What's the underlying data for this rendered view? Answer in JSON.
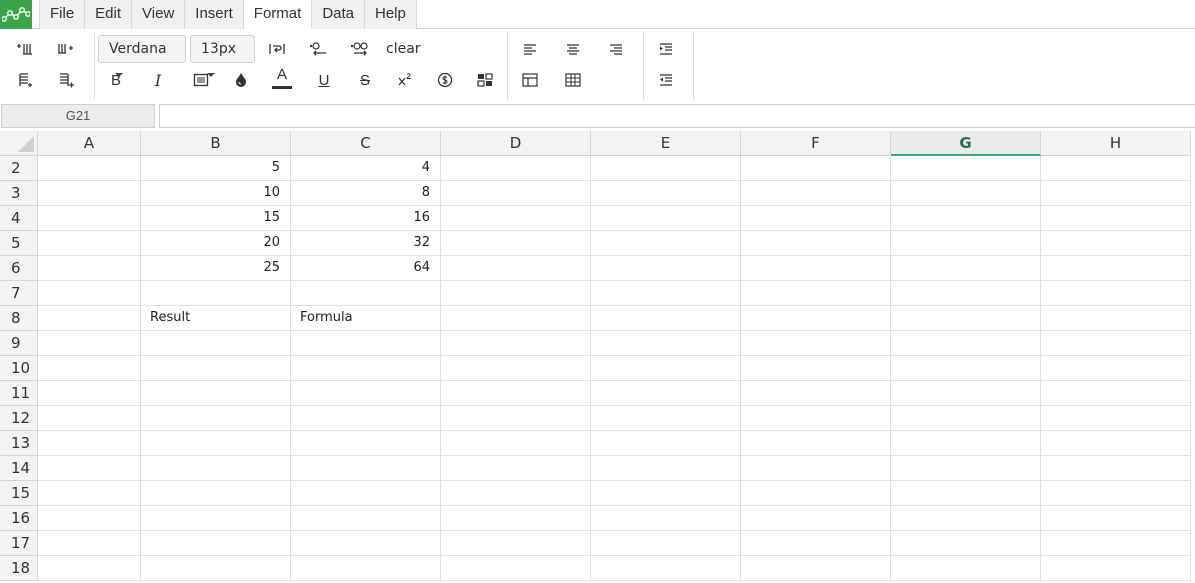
{
  "menu": {
    "items": [
      {
        "label": "File"
      },
      {
        "label": "Edit"
      },
      {
        "label": "View"
      },
      {
        "label": "Insert"
      },
      {
        "label": "Format",
        "active": true
      },
      {
        "label": "Data"
      },
      {
        "label": "Help"
      }
    ]
  },
  "toolbar": {
    "font_family": "Verdana",
    "font_size": "13px",
    "clear_label": "clear",
    "bold_label": "B",
    "italic_label": "I",
    "text_color_label": "A",
    "underline_label": "U",
    "strike_label": "S",
    "text_color_hex": "#333333"
  },
  "formula_bar": {
    "cell_ref": "G21",
    "value": ""
  },
  "sheet": {
    "selected_column": "G",
    "columns": [
      "A",
      "B",
      "C",
      "D",
      "E",
      "F",
      "G",
      "H"
    ],
    "rows": [
      {
        "num": "2",
        "cells": [
          "",
          "5",
          "4",
          "",
          "",
          "",
          "",
          ""
        ]
      },
      {
        "num": "3",
        "cells": [
          "",
          "10",
          "8",
          "",
          "",
          "",
          "",
          ""
        ]
      },
      {
        "num": "4",
        "cells": [
          "",
          "15",
          "16",
          "",
          "",
          "",
          "",
          ""
        ]
      },
      {
        "num": "5",
        "cells": [
          "",
          "20",
          "32",
          "",
          "",
          "",
          "",
          ""
        ]
      },
      {
        "num": "6",
        "cells": [
          "",
          "25",
          "64",
          "",
          "",
          "",
          "",
          ""
        ]
      },
      {
        "num": "7",
        "cells": [
          "",
          "",
          "",
          "",
          "",
          "",
          "",
          ""
        ]
      },
      {
        "num": "8",
        "cells": [
          "",
          "Result",
          "Formula",
          "",
          "",
          "",
          "",
          ""
        ]
      },
      {
        "num": "9",
        "cells": [
          "",
          "",
          "",
          "",
          "",
          "",
          "",
          ""
        ]
      },
      {
        "num": "10",
        "cells": [
          "",
          "",
          "",
          "",
          "",
          "",
          "",
          ""
        ]
      },
      {
        "num": "11",
        "cells": [
          "",
          "",
          "",
          "",
          "",
          "",
          "",
          ""
        ]
      },
      {
        "num": "12",
        "cells": [
          "",
          "",
          "",
          "",
          "",
          "",
          "",
          ""
        ]
      },
      {
        "num": "13",
        "cells": [
          "",
          "",
          "",
          "",
          "",
          "",
          "",
          ""
        ]
      },
      {
        "num": "14",
        "cells": [
          "",
          "",
          "",
          "",
          "",
          "",
          "",
          ""
        ]
      },
      {
        "num": "15",
        "cells": [
          "",
          "",
          "",
          "",
          "",
          "",
          "",
          ""
        ]
      },
      {
        "num": "16",
        "cells": [
          "",
          "",
          "",
          "",
          "",
          "",
          "",
          ""
        ]
      },
      {
        "num": "17",
        "cells": [
          "",
          "",
          "",
          "",
          "",
          "",
          "",
          ""
        ]
      },
      {
        "num": "18",
        "cells": [
          "",
          "",
          "",
          "",
          "",
          "",
          "",
          ""
        ]
      }
    ]
  },
  "colors": {
    "brand": "#3aa449",
    "selected_column_text": "#21734a",
    "selected_column_underline": "#3aa874"
  }
}
